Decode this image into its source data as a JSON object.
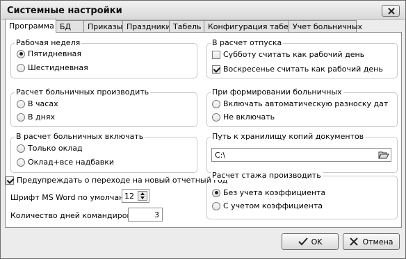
{
  "window": {
    "title": "Системные настройки"
  },
  "tabs": [
    "Программа",
    "БД",
    "Приказы",
    "Праздники",
    "Табель",
    "Конфигурация табеля",
    "Учет больничных"
  ],
  "work_week": {
    "label": "Рабочая неделя",
    "options": [
      "Пятидневная",
      "Шестидневная"
    ],
    "selected": 0
  },
  "sick_calc": {
    "label": "Расчет больничных производить",
    "options": [
      "В часах",
      "В днях"
    ],
    "selected": -1
  },
  "sick_include": {
    "label": "В расчет больничных включать",
    "options": [
      "Только оклад",
      "Оклад+все надбавки"
    ],
    "selected": -1
  },
  "vacation": {
    "label": "В расчет отпуска",
    "saturday": "Субботу считать как рабочий день",
    "sunday": "Воскресенье считать как рабочий день",
    "saturday_checked": false,
    "sunday_checked": true
  },
  "sick_form": {
    "label": "При формировании больничных",
    "options": [
      "Включать автоматическую разноску дат",
      "Не включать"
    ],
    "selected": -1
  },
  "backup": {
    "label": "Путь к хранилищу копий документов",
    "path": "C:\\"
  },
  "warn": {
    "label": "Предупреждать о переходе на новый отчетный год",
    "checked": true
  },
  "font": {
    "label": "Шрифт MS Word по умолчанию",
    "value": "12"
  },
  "trips": {
    "label": "Количество дней командировки",
    "value": "3"
  },
  "seniority": {
    "label": "Расчет стажа производить",
    "options": [
      "Без учета коэффициента",
      "С учетом коэффициента"
    ],
    "selected": 0
  },
  "buttons": {
    "ok": "OK",
    "cancel": "Отмена"
  }
}
